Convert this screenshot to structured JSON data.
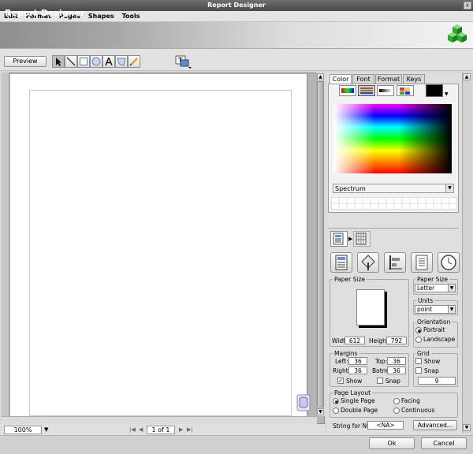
{
  "window": {
    "title": "Report Designer",
    "close_glyph": "x"
  },
  "menu": [
    "Edit",
    "Format",
    "Pages",
    "Shapes",
    "Tools"
  ],
  "banner": {
    "title": "Report Designer",
    "icon": "green-cubes-icon"
  },
  "toolbar": {
    "preview_label": "Preview",
    "tools": [
      "pointer-icon",
      "line-icon",
      "rectangle-icon",
      "ellipse-icon",
      "text-icon",
      "polygon-icon",
      "pencil-icon"
    ],
    "extra_tool": "text-style-icon"
  },
  "status": {
    "zoom": "100%",
    "page": "1 of 1"
  },
  "color_panel": {
    "tabs": [
      "Color",
      "Font",
      "Format",
      "Keys"
    ],
    "active_tab": "Color",
    "mode": "Spectrum",
    "current_color": "#000000"
  },
  "page_tabs": [
    "page-setup-icon",
    "page-grid-icon"
  ],
  "big_icons": [
    "page-setup-icon",
    "fill-bucket-icon",
    "align-icon",
    "list-icon",
    "clock-icon"
  ],
  "paper_size": {
    "title": "Paper Size",
    "width_label": "Width:",
    "width": "612",
    "height_label": "Height:",
    "height": "792"
  },
  "paper_size_select": {
    "title": "Paper Size",
    "value": "Letter"
  },
  "units": {
    "title": "Units",
    "value": "point"
  },
  "orientation": {
    "title": "Orientation",
    "portrait": "Portrait",
    "landscape": "Landscape",
    "selected": "Portrait"
  },
  "margins": {
    "title": "Margins",
    "left_label": "Left:",
    "left": "36",
    "top_label": "Top:",
    "top": "36",
    "right_label": "Right:",
    "right": "36",
    "bottom_label": "Botm:",
    "bottom": "36",
    "show_label": "Show",
    "show_checked": true,
    "snap_label": "Snap",
    "snap_checked": false
  },
  "grid": {
    "title": "Grid",
    "show_label": "Show",
    "snap_label": "Snap",
    "size": "9"
  },
  "page_layout": {
    "title": "Page Layout",
    "single": "Single Page",
    "facing": "Facing",
    "double": "Double Page",
    "continuous": "Continuous",
    "selected": "Single Page"
  },
  "null_string": {
    "label": "String for Null",
    "value": "<NA>",
    "advanced_label": "Advanced..."
  },
  "dialog": {
    "ok_label": "Ok",
    "cancel_label": "Cancel"
  }
}
